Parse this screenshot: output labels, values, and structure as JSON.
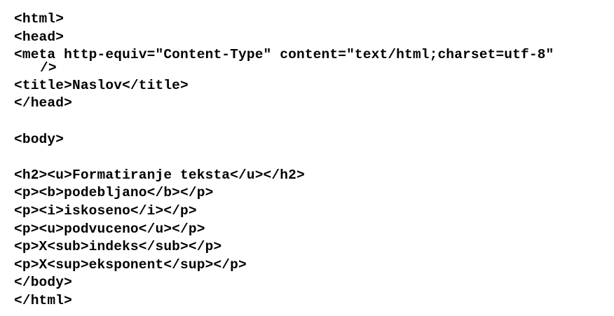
{
  "code": {
    "lines": [
      "<html>",
      "<head>",
      "<meta http-equiv=\"Content-Type\" content=\"text/html;charset=utf-8\"",
      "/>",
      "<title>Naslov</title>",
      "</head>",
      "",
      "<body>",
      "",
      "<h2><u>Formatiranje teksta</u></h2>",
      "<p><b>podebljano</b></p>",
      "<p><i>iskoseno</i></p>",
      "<p><u>podvuceno</u></p>",
      "<p>X<sub>indeks</sub></p>",
      "<p>X<sup>eksponent</sup></p>",
      "</body>",
      "</html>"
    ]
  }
}
